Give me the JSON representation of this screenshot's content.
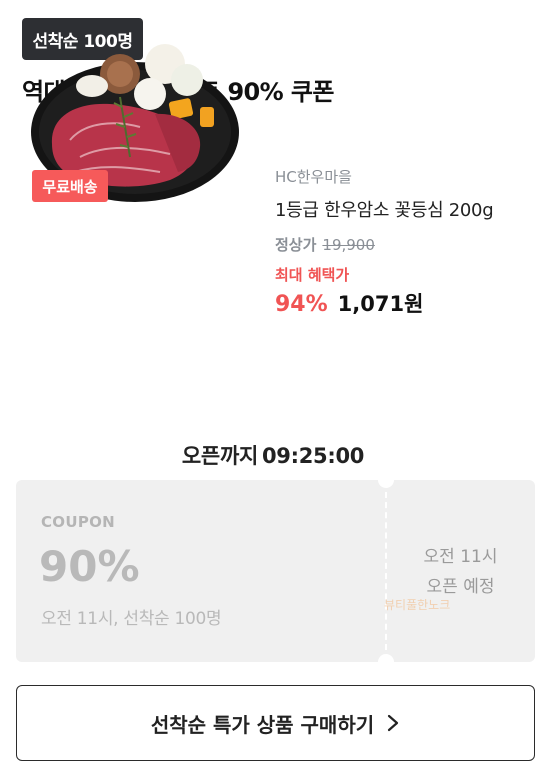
{
  "badge": "선착순 100명",
  "headline": "역대급 가격! 오마트 90% 쿠폰",
  "product": {
    "free_shipping": "무료배송",
    "brand": "HC한우마을",
    "name": "1등급 한우암소 꽃등심 200g",
    "regular_label": "정상가",
    "regular_price": "19,900",
    "benefit_label": "최대 혜택가",
    "discount_percent": "94%",
    "sale_price": "1,071원",
    "image_icon": "beef-steak-plate-image"
  },
  "countdown": {
    "label": "오픈까지",
    "time": "09:25:00"
  },
  "coupon": {
    "label": "COUPON",
    "percent": "90%",
    "desc": "오전 11시, 선착순 100명",
    "open_line1": "오전 11시",
    "open_line2": "오픈 예정",
    "watermark": "뷰티풀한노크"
  },
  "cta": {
    "label": "선착순 특가 상품 구매하기",
    "icon": "chevron-right-icon"
  },
  "colors": {
    "accent_red": "#f05454",
    "badge_bg": "#2d2f33",
    "coupon_bg": "#f0f0f0"
  }
}
